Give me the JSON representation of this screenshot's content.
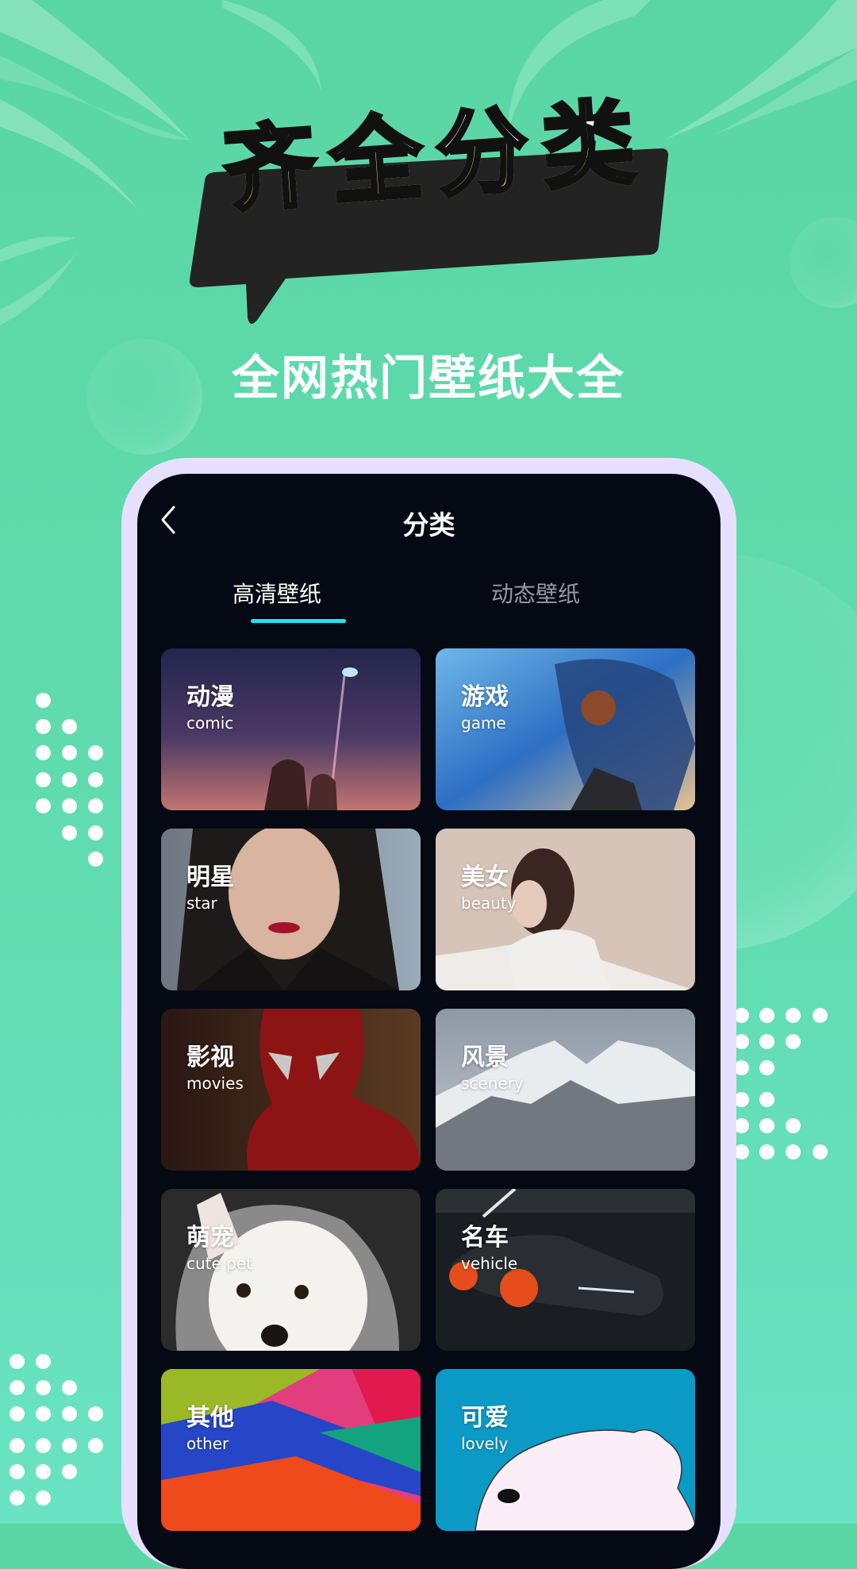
{
  "promo": {
    "headline": "齐全分类",
    "subtitle": "全网热门壁纸大全"
  },
  "screen": {
    "back_icon": "chevron-left-icon",
    "title": "分类",
    "tabs": [
      {
        "label": "高清壁纸",
        "active": true
      },
      {
        "label": "动态壁纸",
        "active": false
      }
    ],
    "accent_color": "#1fe6f0",
    "categories": [
      {
        "cn": "动漫",
        "en": "comic"
      },
      {
        "cn": "游戏",
        "en": "game"
      },
      {
        "cn": "明星",
        "en": "star"
      },
      {
        "cn": "美女",
        "en": "beauty"
      },
      {
        "cn": "影视",
        "en": "movies"
      },
      {
        "cn": "风景",
        "en": "scenery"
      },
      {
        "cn": "萌宠",
        "en": "cute pet"
      },
      {
        "cn": "名车",
        "en": "vehicle"
      },
      {
        "cn": "其他",
        "en": "other"
      },
      {
        "cn": "可爱",
        "en": "lovely"
      }
    ]
  },
  "colors": {
    "background": "#5ad6a5",
    "phone_frame": "#e6e0fe",
    "screen_bg": "#050914",
    "headline_yellow": "#fff47a",
    "banner": "#232323"
  }
}
